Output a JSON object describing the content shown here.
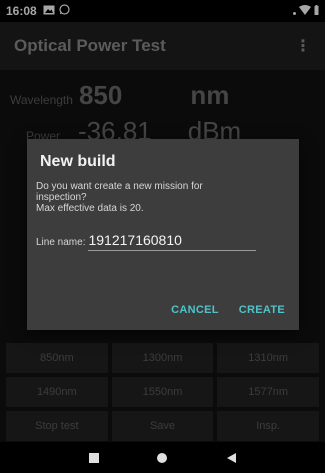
{
  "status_bar": {
    "time": "16:08"
  },
  "app_bar": {
    "title": "Optical Power Test",
    "overflow_glyph": "⋮"
  },
  "readings": {
    "wavelength": {
      "label": "Wavelength",
      "value": "850",
      "unit": "nm"
    },
    "power": {
      "label": "Power",
      "value": "-36.81",
      "unit": "dBm"
    }
  },
  "wavelength_buttons": [
    "850nm",
    "1300nm",
    "1310nm",
    "1490nm",
    "1550nm",
    "1577nm"
  ],
  "action_buttons": [
    "Stop test",
    "Save",
    "Insp."
  ],
  "dialog": {
    "title": "New build",
    "message_line1": "Do you want create a new mission for",
    "message_line2": "inspection?",
    "message_line3": "Max effective data is 20.",
    "line_label": "Line name:",
    "line_value": "191217160810",
    "cancel_label": "CANCEL",
    "create_label": "CREATE",
    "accent_color": "#4fc3c8"
  },
  "icons": {
    "status_left": [
      "image-icon",
      "whatsapp-icon"
    ],
    "status_right": [
      "wifi-icon",
      "battery-icon"
    ],
    "nav": [
      "recents-icon",
      "home-icon",
      "back-icon"
    ]
  }
}
